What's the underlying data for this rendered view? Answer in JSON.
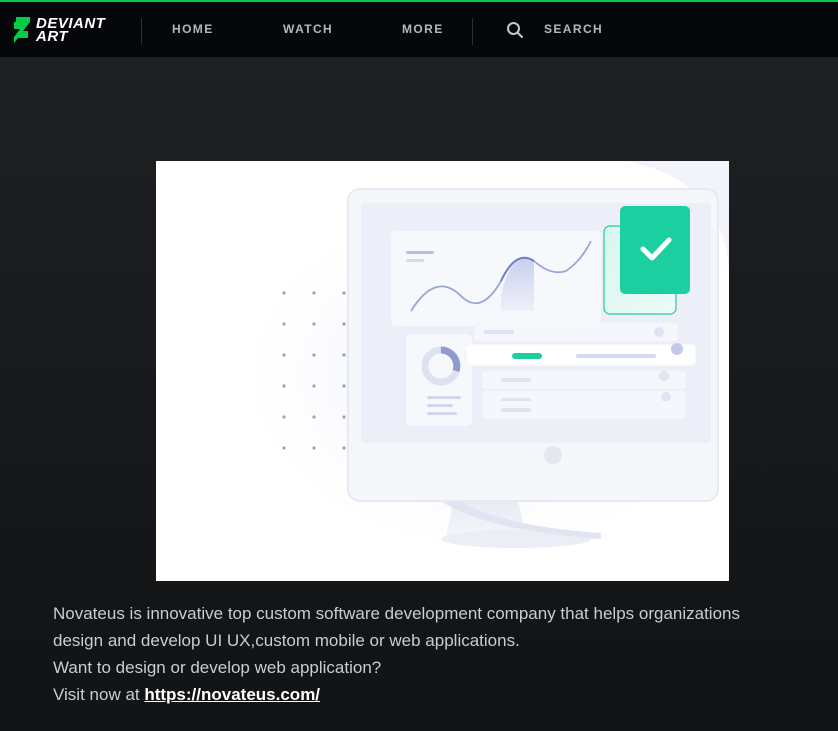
{
  "brand": {
    "logo_text": "DEVIANT\nART",
    "logo_icon": "deviantart-logo-icon",
    "accent_color": "#05cc47"
  },
  "nav": {
    "home": "HOME",
    "watch": "WATCH",
    "more": "MORE",
    "search_label": "SEARCH",
    "search_icon": "search-icon"
  },
  "artwork": {
    "icon": "checkmark-icon",
    "accent_color": "#1ccfa1"
  },
  "description": {
    "line1": "Novateus is innovative top custom software development company that helps organizations",
    "line2": "design and develop UI UX,custom mobile or  web applications.",
    "line3": "Want to design or develop web application?",
    "line4_prefix": "Visit now at ",
    "link_text": "https://novateus.com/"
  }
}
